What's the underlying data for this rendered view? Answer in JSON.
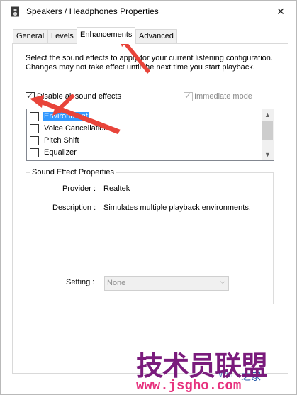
{
  "window": {
    "title": "Speakers / Headphones Properties",
    "close_glyph": "✕"
  },
  "tabs": [
    {
      "label": "General",
      "active": false
    },
    {
      "label": "Levels",
      "active": false
    },
    {
      "label": "Enhancements",
      "active": true
    },
    {
      "label": "Advanced",
      "active": false
    }
  ],
  "enhancements": {
    "description": "Select the sound effects to apply for your current listening configuration. Changes may not take effect until the next time you start playback.",
    "disable_all": {
      "label": "Disable all sound effects",
      "checked": true
    },
    "immediate_mode": {
      "label": "Immediate mode",
      "checked": true,
      "enabled": false
    },
    "effects": [
      {
        "label": "Environment",
        "checked": false,
        "selected": true
      },
      {
        "label": "Voice Cancellation",
        "checked": false,
        "selected": false
      },
      {
        "label": "Pitch Shift",
        "checked": false,
        "selected": false
      },
      {
        "label": "Equalizer",
        "checked": false,
        "selected": false
      }
    ],
    "properties": {
      "group_title": "Sound Effect Properties",
      "provider_label": "Provider :",
      "provider_value": "Realtek",
      "description_label": "Description :",
      "description_value": "Simulates multiple playback environments.",
      "setting_label": "Setting :",
      "setting_value": "None"
    }
  },
  "watermark": {
    "big_text": "技术员联盟",
    "url": "www.jsgho.com",
    "small_text": "之家",
    "win_text": "Win"
  },
  "colors": {
    "selection": "#3399ff",
    "annotation_arrow": "#e8443a",
    "watermark_purple": "#7a1b7c",
    "watermark_pink": "#e7327e"
  }
}
